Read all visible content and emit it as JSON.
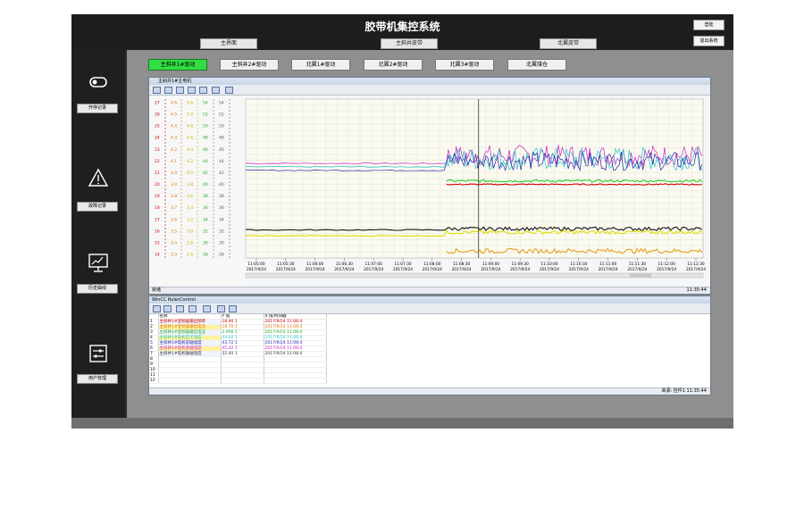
{
  "app": {
    "title": "胶带机集控系统"
  },
  "top_buttons": {
    "login": "登陆",
    "exit": "退出系统"
  },
  "nav_tabs": [
    "主界面",
    "主斜井皮带",
    "北翼皮带"
  ],
  "sidebar": {
    "items": [
      {
        "label": "开停记录",
        "icon": "switch-icon"
      },
      {
        "label": "故障记录",
        "icon": "warning-icon"
      },
      {
        "label": "历史曲线",
        "icon": "monitor-chart-icon"
      },
      {
        "label": "用户管理",
        "icon": "sliders-icon"
      }
    ]
  },
  "drive_tabs": [
    {
      "label": "主斜井1#驱动",
      "active": true
    },
    {
      "label": "主斜井2#驱动",
      "active": false
    },
    {
      "label": "北翼1#驱动",
      "active": false
    },
    {
      "label": "北翼2#驱动",
      "active": false
    },
    {
      "label": "北翼3#驱动",
      "active": false
    },
    {
      "label": "北翼煤仓",
      "active": false
    }
  ],
  "trend_window": {
    "title": "主斜井1#主电机",
    "status_left": "就绪",
    "status_time": "11:35:44",
    "axes": [
      {
        "color": "#c80000",
        "ticks": [
          "27",
          "26",
          "25",
          "24",
          "23",
          "22",
          "21",
          "20",
          "19",
          "18",
          "17",
          "16",
          "15",
          "14"
        ]
      },
      {
        "color": "#e07800",
        "ticks": [
          "4.6",
          "4.5",
          "4.4",
          "4.3",
          "4.2",
          "4.1",
          "4.0",
          "3.9",
          "3.8",
          "3.7",
          "3.6",
          "3.5",
          "3.4",
          "3.3"
        ]
      },
      {
        "color": "#b8b800",
        "ticks": [
          "5.6",
          "5.0",
          "4.8",
          "4.6",
          "4.4",
          "4.2",
          "4.0",
          "3.8",
          "3.6",
          "3.4",
          "3.2",
          "3.0",
          "2.8",
          "2.6"
        ]
      },
      {
        "color": "#22aa22",
        "ticks": [
          "54",
          "52",
          "50",
          "48",
          "46",
          "44",
          "42",
          "40",
          "38",
          "36",
          "34",
          "32",
          "30",
          "28"
        ]
      },
      {
        "color": "#5a5a5a",
        "ticks": [
          "54",
          "52",
          "50",
          "48",
          "46",
          "44",
          "42",
          "40",
          "38",
          "36",
          "34",
          "32",
          "30",
          "28"
        ]
      }
    ],
    "x_ticks": [
      {
        "time": "11:05:00",
        "date": "2017/9/24"
      },
      {
        "time": "11:05:30",
        "date": "2017/9/24"
      },
      {
        "time": "11:06:00",
        "date": "2017/9/24"
      },
      {
        "time": "11:06:30",
        "date": "2017/9/24"
      },
      {
        "time": "11:07:00",
        "date": "2017/9/24"
      },
      {
        "time": "11:07:30",
        "date": "2017/9/24"
      },
      {
        "time": "11:08:00",
        "date": "2017/9/24"
      },
      {
        "time": "11:08:30",
        "date": "2017/9/24"
      },
      {
        "time": "11:09:00",
        "date": "2017/9/24"
      },
      {
        "time": "11:09:30",
        "date": "2017/9/24"
      },
      {
        "time": "11:10:00",
        "date": "2017/9/24"
      },
      {
        "time": "11:10:30",
        "date": "2017/9/24"
      },
      {
        "time": "11:11:00",
        "date": "2017/9/24"
      },
      {
        "time": "11:11:30",
        "date": "2017/9/24"
      },
      {
        "time": "11:12:00",
        "date": "2017/9/24"
      },
      {
        "time": "11:12:30",
        "date": "2017/9/24"
      }
    ]
  },
  "chart_data": {
    "type": "line",
    "x_range": [
      "11:05:00",
      "11:12:40"
    ],
    "y_range": [
      14,
      27
    ],
    "grid": true,
    "series": [
      {
        "color": "#cc22cc",
        "before": 21.8,
        "after": 22.5,
        "noise": 0.9
      },
      {
        "color": "#22c8c8",
        "before": 21.5,
        "after": 22.2,
        "noise": 1.0
      },
      {
        "color": "#2222aa",
        "before": 21.2,
        "after": 22.0,
        "noise": 0.8
      },
      {
        "color": "#22cc22",
        "before": null,
        "after": 20.3,
        "noise": 0.1
      },
      {
        "color": "#cc0000",
        "before": null,
        "after": 20.0,
        "noise": 0.05
      },
      {
        "color": "#111111",
        "before": 16.1,
        "after": 16.2,
        "noise": 0.15
      },
      {
        "color": "#dddd00",
        "before": 15.6,
        "after": 15.9,
        "noise": 0.15
      },
      {
        "color": "#e8a020",
        "before": null,
        "after": 14.3,
        "noise": 0.2
      }
    ]
  },
  "ruler": {
    "title": "WinCC RulerControl",
    "headers": [
      "",
      "名称",
      "Y 值",
      "X 值/时间戳"
    ],
    "rows": [
      {
        "n": "1",
        "name": "主斜井1#变频器输出频率",
        "y": "18.90 1",
        "x": "2017/9/24 11:08:4",
        "color": "#cc0000"
      },
      {
        "n": "2",
        "name": "主斜井1#变频器输出电流",
        "y": "18.70 1",
        "x": "2017/9/24 11:08:4",
        "color": "#e07800"
      },
      {
        "n": "3",
        "name": "主斜井1#变频器输出电压",
        "y": "3.906 1",
        "x": "2017/9/24 11:08:4",
        "color": "#22aa22"
      },
      {
        "n": "4",
        "name": "主斜井1#电机定子温度",
        "y": "44.60 1",
        "x": "2017/9/24 11:08:4",
        "color": "#22c8c8"
      },
      {
        "n": "5",
        "name": "主斜井1#电机前轴温度",
        "y": "43.72 1",
        "x": "2017/9/24 11:08:4",
        "color": "#2222aa"
      },
      {
        "n": "6",
        "name": "主斜井1#电机后轴温度",
        "y": "45.42 1",
        "x": "2017/9/24 11:08:4",
        "color": "#cc22cc"
      },
      {
        "n": "7",
        "name": "主斜井1#电机轴轴温度",
        "y": "32.40 1",
        "x": "2017/9/24 11:08:4",
        "color": "#333333"
      },
      {
        "n": "8",
        "name": "",
        "y": "",
        "x": "",
        "color": "#000"
      },
      {
        "n": "9",
        "name": "",
        "y": "",
        "x": "",
        "color": "#000"
      },
      {
        "n": "10",
        "name": "",
        "y": "",
        "x": "",
        "color": "#000"
      },
      {
        "n": "11",
        "name": "",
        "y": "",
        "x": "",
        "color": "#000"
      },
      {
        "n": "12",
        "name": "",
        "y": "",
        "x": "",
        "color": "#000"
      }
    ],
    "status": "来源: 控件1  11:35:44"
  }
}
